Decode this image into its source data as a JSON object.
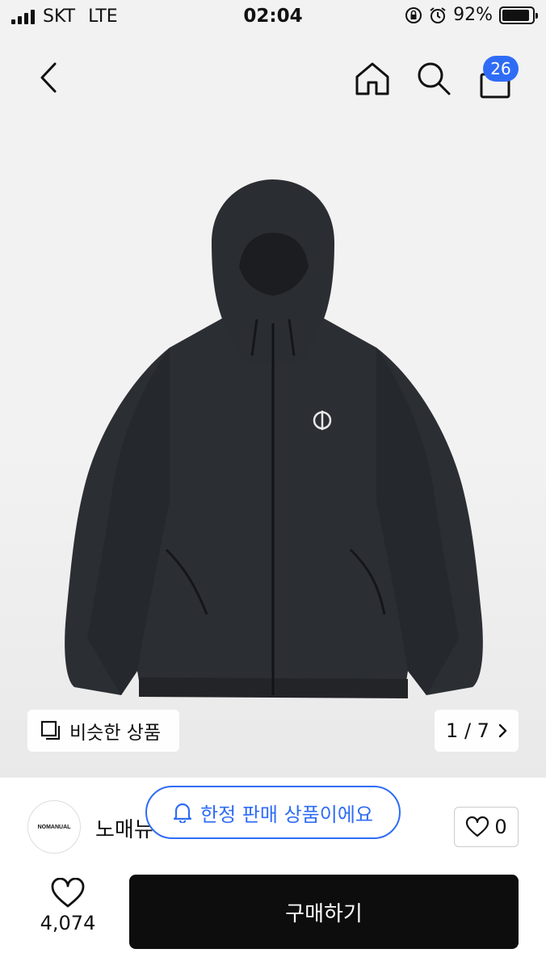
{
  "status_bar": {
    "carrier": "SKT",
    "network": "LTE",
    "time": "02:04",
    "battery": "92%"
  },
  "nav": {
    "back_icon": "chevron-left-icon",
    "home_icon": "home-icon",
    "search_icon": "search-icon",
    "cart_icon": "shopping-bag-icon",
    "cart_count": "26"
  },
  "gallery": {
    "similar_label": "비슷한 상품",
    "page_indicator": "1 / 7"
  },
  "seller": {
    "logo_text": "NOMANUAL",
    "name": "노매뉴"
  },
  "toast": {
    "text": "한정 판매 상품이에요"
  },
  "wishlist": {
    "count": "0"
  },
  "likes": {
    "count": "4,074"
  },
  "actions": {
    "buy_label": "구매하기"
  },
  "colors": {
    "accent": "#2f6cf6",
    "buy_bg": "#0d0d0d",
    "jacket": "#2b2e33"
  }
}
